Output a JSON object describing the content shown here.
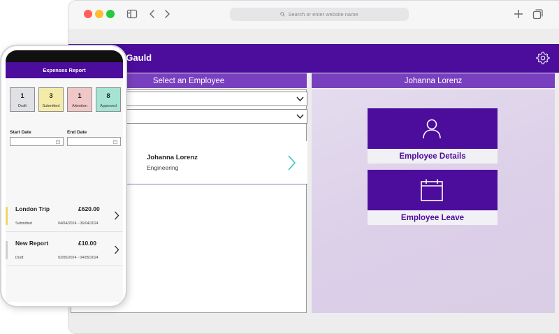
{
  "browser": {
    "url_placeholder": "Search or enter website name",
    "icons": [
      "sidebar-icon",
      "back-icon",
      "forward-icon",
      "new-tab-icon",
      "tabs-overview-icon",
      "search-icon"
    ]
  },
  "app": {
    "header": {
      "user_name": "ir Gauld",
      "icon": "gear-icon"
    },
    "left_panel": {
      "title": "Select an Employee",
      "employee": {
        "name": "Johanna Lorenz",
        "department": "Engineering"
      }
    },
    "right_panel": {
      "title": "Johanna Lorenz",
      "tiles": [
        {
          "label": "Employee Details",
          "icon": "person-icon"
        },
        {
          "label": "Employee Leave",
          "icon": "calendar-icon"
        }
      ]
    }
  },
  "phone": {
    "title": "Expenses Report",
    "counts": [
      {
        "value": "1",
        "label": "Draft",
        "color": "#dfe1e5"
      },
      {
        "value": "3",
        "label": "Submitted",
        "color": "#f5eba8"
      },
      {
        "value": "1",
        "label": "Attention",
        "color": "#f0c7c7"
      },
      {
        "value": "8",
        "label": "Approved",
        "color": "#a5e3d2"
      }
    ],
    "start_date_label": "Start Date",
    "end_date_label": "End Date",
    "reports": [
      {
        "title": "London Trip",
        "amount": "£620.00",
        "status": "Submitted",
        "dates": "04/04/2024 - 06/04/2024",
        "accent": "#f0d66a"
      },
      {
        "title": "New Report",
        "amount": "£10.00",
        "status": "Draft",
        "dates": "02/05/2024 - 04/05/2024",
        "accent": "#cfcfd3"
      }
    ]
  },
  "colors": {
    "brand": "#4c0c9c",
    "panel_header": "#7840be",
    "accent_chevron": "#3cc3c3"
  }
}
